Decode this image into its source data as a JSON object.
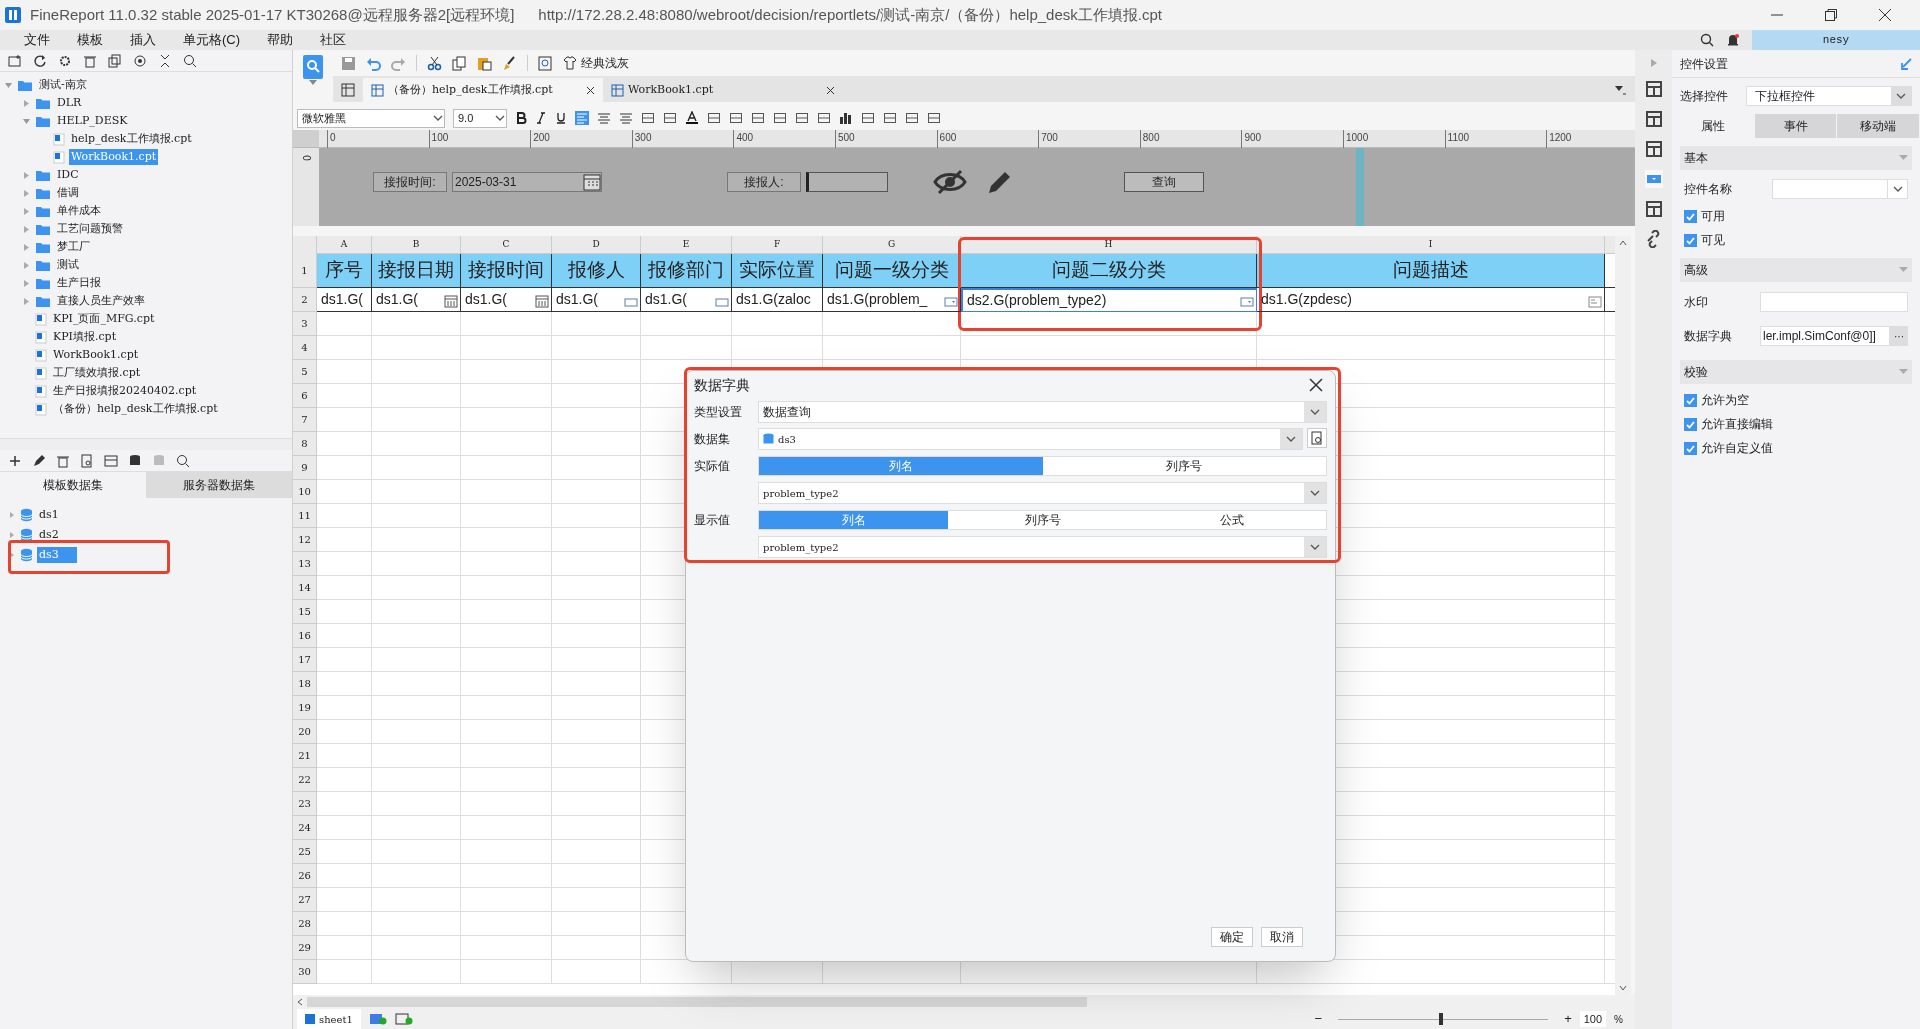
{
  "window": {
    "title": "FineReport 11.0.32 stable 2025-01-17 KT30268@远程服务器2[远程环境]",
    "url": "http://172.28.2.48:8080/webroot/decision/reportlets/测试-南京/（备份）help_desk工作填报.cpt",
    "user": "nesy"
  },
  "menu": [
    "文件",
    "模板",
    "插入",
    "单元格(C)",
    "帮助",
    "社区"
  ],
  "file_tree": [
    {
      "label": "测试-南京",
      "kind": "folder",
      "expanded": true,
      "selected": false,
      "children": [
        {
          "label": "DLR",
          "kind": "folder",
          "expanded": false,
          "selected": false
        },
        {
          "label": "HELP_DESK",
          "kind": "folder",
          "expanded": true,
          "selected": false,
          "children": [
            {
              "label": "help_desk工作填报.cpt",
              "kind": "file",
              "selected": false
            },
            {
              "label": "WorkBook1.cpt",
              "kind": "file",
              "selected": true
            }
          ]
        },
        {
          "label": "IDC",
          "kind": "folder",
          "expanded": false,
          "selected": false
        },
        {
          "label": "借调",
          "kind": "folder",
          "expanded": false,
          "selected": false
        },
        {
          "label": "单件成本",
          "kind": "folder",
          "expanded": false,
          "selected": false
        },
        {
          "label": "工艺问题预警",
          "kind": "folder",
          "expanded": false,
          "selected": false
        },
        {
          "label": "梦工厂",
          "kind": "folder",
          "expanded": false,
          "selected": false
        },
        {
          "label": "测试",
          "kind": "folder",
          "expanded": false,
          "selected": false
        },
        {
          "label": "生产日报",
          "kind": "folder",
          "expanded": false,
          "selected": false
        },
        {
          "label": "直接人员生产效率",
          "kind": "folder",
          "expanded": false,
          "selected": false
        },
        {
          "label": "KPI_页面_MFG.cpt",
          "kind": "file",
          "selected": false
        },
        {
          "label": "KPI填报.cpt",
          "kind": "file",
          "selected": false
        },
        {
          "label": "WorkBook1.cpt",
          "kind": "file",
          "selected": false
        },
        {
          "label": "工厂绩效填报.cpt",
          "kind": "file",
          "selected": false
        },
        {
          "label": "生产日报填报20240402.cpt",
          "kind": "file",
          "selected": false
        },
        {
          "label": "（备份）help_desk工作填报.cpt",
          "kind": "file",
          "selected": false
        }
      ]
    }
  ],
  "dataset_tabs": [
    {
      "label": "模板数据集",
      "selected": true
    },
    {
      "label": "服务器数据集",
      "selected": false
    }
  ],
  "datasets": [
    {
      "label": "ds1",
      "selected": false
    },
    {
      "label": "ds2",
      "selected": false
    },
    {
      "label": "ds3",
      "selected": true,
      "annotated": true
    }
  ],
  "toolbar": {
    "theme_button": "经典浅灰",
    "font": "微软雅黑",
    "font_size": "9.0"
  },
  "editor_tabs": [
    {
      "label": "（备份）help_desk工作填报.cpt",
      "selected": true
    },
    {
      "label": "WorkBook1.cpt",
      "selected": false
    }
  ],
  "ruler": {
    "vertical": "0",
    "marks": [
      "0",
      "100",
      "200",
      "300",
      "400",
      "500",
      "600",
      "700",
      "800",
      "900",
      "1000",
      "1100",
      "1200"
    ]
  },
  "parameter_panel": {
    "date_label": "接报时间:",
    "date_value": "2025-03-31",
    "person_label": "接报人:",
    "query_button": "查询"
  },
  "sheet": {
    "columns": [
      {
        "letter": "A",
        "header": "序号",
        "cell": "ds1.G(",
        "kind": "plain",
        "selected": false
      },
      {
        "letter": "B",
        "header": "接报日期",
        "cell": "ds1.G(",
        "kind": "date",
        "selected": false
      },
      {
        "letter": "C",
        "header": "接报时间",
        "cell": "ds1.G(",
        "kind": "date",
        "selected": false
      },
      {
        "letter": "D",
        "header": "报修人",
        "cell": "ds1.G(",
        "kind": "text",
        "selected": false
      },
      {
        "letter": "E",
        "header": "报修部门",
        "cell": "ds1.G(",
        "kind": "text",
        "selected": false
      },
      {
        "letter": "F",
        "header": "实际位置",
        "cell": "ds1.G(zaloc",
        "kind": "plain",
        "selected": false
      },
      {
        "letter": "G",
        "header": "问题一级分类",
        "cell": "ds1.G(problem_",
        "kind": "dropdown",
        "selected": false
      },
      {
        "letter": "H",
        "header": "问题二级分类",
        "cell": "ds2.G(problem_type2)",
        "kind": "dropdown",
        "selected": true,
        "annotated": true
      },
      {
        "letter": "I",
        "header": "问题描述",
        "cell": "ds1.G(zpdesc)",
        "kind": "textarea",
        "selected": false
      }
    ],
    "row_numbers": [
      "1",
      "2",
      "3",
      "4",
      "5",
      "6",
      "7",
      "8",
      "9",
      "10",
      "11",
      "12",
      "13",
      "14",
      "15",
      "16",
      "17",
      "18",
      "19",
      "20",
      "21",
      "22",
      "23",
      "24",
      "25",
      "26",
      "27",
      "28",
      "29",
      "30"
    ]
  },
  "sheet_tabs": [
    {
      "label": "sheet1",
      "selected": true
    }
  ],
  "zoom": {
    "minus": "−",
    "plus": "+",
    "value": "100",
    "unit": "%",
    "level": 0.48
  },
  "dialog": {
    "title": "数据字典",
    "annotated": true,
    "type_label": "类型设置",
    "type_value": "数据查询",
    "dataset_label": "数据集",
    "dataset_value": "ds3",
    "actual_label": "实际值",
    "actual_modes": [
      {
        "label": "列名",
        "selected": true
      },
      {
        "label": "列序号",
        "selected": false
      }
    ],
    "actual_value": "problem_type2",
    "display_label": "显示值",
    "display_modes": [
      {
        "label": "列名",
        "selected": true
      },
      {
        "label": "列序号",
        "selected": false
      },
      {
        "label": "公式",
        "selected": false
      }
    ],
    "display_value": "problem_type2",
    "ok": "确定",
    "cancel": "取消"
  },
  "right_panel": {
    "title": "控件设置",
    "select_label": "选择控件",
    "select_value": "下拉框控件",
    "tabs": [
      {
        "label": "属性",
        "selected": true
      },
      {
        "label": "事件",
        "selected": false
      },
      {
        "label": "移动端",
        "selected": false
      }
    ],
    "sections": [
      {
        "title": "基本",
        "items": [
          {
            "kind": "dropdown",
            "label": "控件名称"
          },
          {
            "kind": "checkbox",
            "label": "可用",
            "checked": true
          },
          {
            "kind": "checkbox",
            "label": "可见",
            "checked": true
          }
        ]
      },
      {
        "title": "高级",
        "items": [
          {
            "kind": "field",
            "label": "水印"
          },
          {
            "kind": "picker",
            "label": "数据字典",
            "value": "ler.impl.SimConf@0]]",
            "button": "···"
          }
        ]
      },
      {
        "title": "校验",
        "items": [
          {
            "kind": "checkbox",
            "label": "允许为空",
            "checked": true
          },
          {
            "kind": "checkbox",
            "label": "允许直接编辑",
            "checked": true
          },
          {
            "kind": "checkbox",
            "label": "允许自定义值",
            "checked": true
          }
        ]
      }
    ]
  }
}
